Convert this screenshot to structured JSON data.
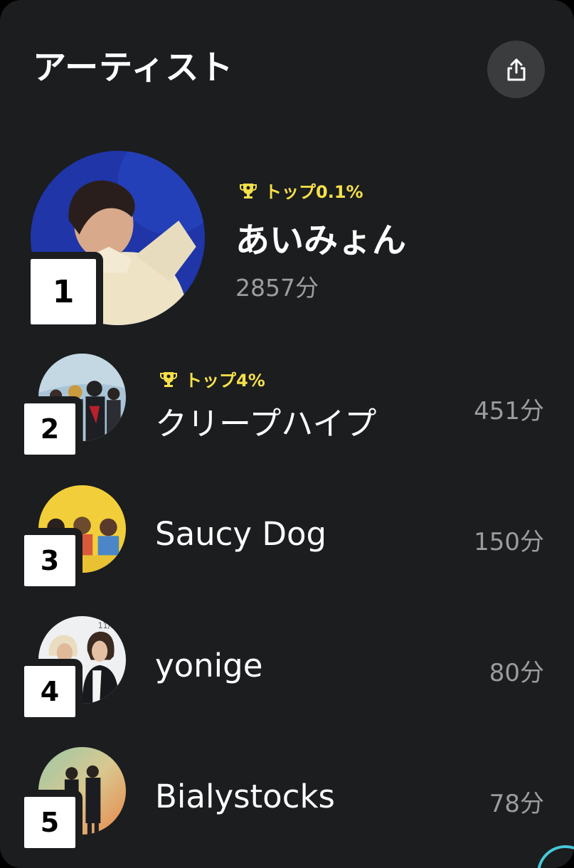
{
  "header": {
    "title": "アーティスト"
  },
  "share_icon": "share-icon",
  "colors": {
    "background": "#1b1d1f",
    "badge": "#f5e04a",
    "minutes": "#9a9c9e",
    "share_button": "#3a3c3e"
  },
  "artists": [
    {
      "rank": "1",
      "badge": "トップ0.1%",
      "name": "あいみょん",
      "minutes": "2857分"
    },
    {
      "rank": "2",
      "badge": "トップ4%",
      "name": "クリープハイプ",
      "minutes": "451分"
    },
    {
      "rank": "3",
      "name": "Saucy Dog",
      "minutes": "150分"
    },
    {
      "rank": "4",
      "name": "yonige",
      "minutes": "80分"
    },
    {
      "rank": "5",
      "name": "Bialystocks",
      "minutes": "78分"
    }
  ]
}
